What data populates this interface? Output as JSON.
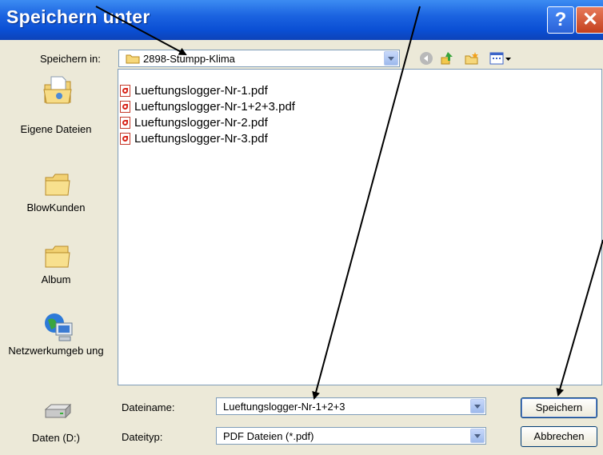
{
  "window": {
    "title": "Speichern unter"
  },
  "titlebar": {
    "help_glyph": "?",
    "close_glyph": "✕"
  },
  "toolbar": {
    "save_in_label": "Speichern in:",
    "current_folder": "2898-Stumpp-Klima",
    "icons": [
      "back-icon",
      "up-folder-icon",
      "new-folder-icon",
      "view-menu-icon"
    ]
  },
  "sidebar": {
    "items": [
      {
        "label": "Eigene Dateien",
        "icon": "my-documents-icon"
      },
      {
        "label": "BlowKunden",
        "icon": "folder-icon"
      },
      {
        "label": "Album",
        "icon": "folder-icon"
      },
      {
        "label": "Netzwerkumgeb ung",
        "icon": "network-icon"
      },
      {
        "label": "Daten (D:)",
        "icon": "drive-icon"
      }
    ]
  },
  "files": [
    "Lueftungslogger-Nr-1.pdf",
    "Lueftungslogger-Nr-1+2+3.pdf",
    "Lueftungslogger-Nr-2.pdf",
    "Lueftungslogger-Nr-3.pdf"
  ],
  "form": {
    "filename_label": "Dateiname:",
    "filename_value": "Lueftungslogger-Nr-1+2+3",
    "filetype_label": "Dateityp:",
    "filetype_value": "PDF Dateien (*.pdf)"
  },
  "buttons": {
    "save": "Speichern",
    "cancel": "Abbrechen"
  },
  "colors": {
    "titlebar": "#0a4fd4",
    "dialog_bg": "#ece9d8",
    "annotation_arrows": "#000000"
  }
}
